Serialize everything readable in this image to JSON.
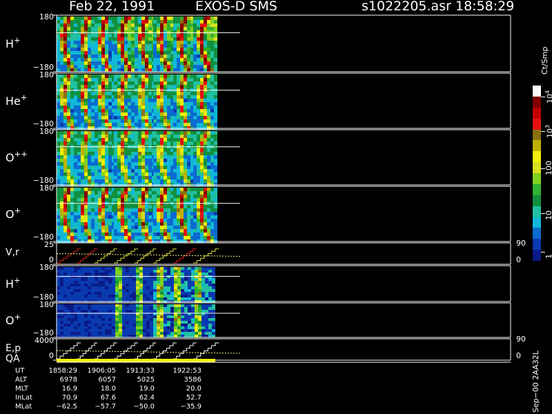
{
  "header": {
    "date": "Feb 22, 1991",
    "instrument": "EXOS-D SMS",
    "file": "s1022205.asr",
    "time": "18:58:29"
  },
  "chart_data": {
    "type": "heatmap",
    "panels": [
      {
        "id": "h_plus",
        "species": "H",
        "charge": "+",
        "ymax": "180",
        "ymin": "−180"
      },
      {
        "id": "he_plus",
        "species": "He",
        "charge": "+",
        "ymax": "180",
        "ymin": "−180"
      },
      {
        "id": "o_pp",
        "species": "O",
        "charge": "++",
        "ymax": "180",
        "ymin": "−180"
      },
      {
        "id": "o_plus",
        "species": "O",
        "charge": "+",
        "ymax": "180",
        "ymin": "−180"
      },
      {
        "id": "vr",
        "label": "V,r",
        "ymax": "25",
        "ymin": "0",
        "right_top": "90",
        "right_bottom": "0"
      },
      {
        "id": "h_plus_2",
        "species": "H",
        "charge": "+",
        "ymax": "180",
        "ymin": "−180"
      },
      {
        "id": "o_plus_2",
        "species": "O",
        "charge": "+",
        "ymax": "180",
        "ymin": "−180"
      },
      {
        "id": "ep",
        "label": "E,p",
        "ymax": "4000",
        "ymin": "0",
        "right_top": "90",
        "right_bottom": "0"
      }
    ],
    "qa_label": "QA",
    "spin_bands": 8,
    "colorbar": {
      "units": "Ct/Smp",
      "labels": [
        "1",
        "10",
        "100"
      ],
      "label_1e3": "10",
      "label_1e3_exp": "3",
      "label_1e4": "10",
      "label_1e4_exp": "4",
      "colors": [
        "#0a1a88",
        "#0a3ab0",
        "#0a6ad0",
        "#10b8d8",
        "#20c0a0",
        "#109040",
        "#30b030",
        "#80d020",
        "#d8e020",
        "#f0f000",
        "#c0b000",
        "#8a7010",
        "#e81010",
        "#c00000",
        "#800000",
        "#f8f8f8"
      ]
    }
  },
  "footer": {
    "rows": [
      {
        "label": "UT",
        "values": [
          "1858:29",
          "1906:05",
          "1913:33",
          "1922:53"
        ]
      },
      {
        "label": "ALT",
        "values": [
          "6978",
          "6057",
          "5025",
          "3586"
        ]
      },
      {
        "label": "MLT",
        "values": [
          "16.9",
          "18.0",
          "19.0",
          "20.0"
        ]
      },
      {
        "label": "InLat",
        "values": [
          "70.9",
          "67.6",
          "62.4",
          "52.7"
        ]
      },
      {
        "label": "MLat",
        "values": [
          "−62.5",
          "−57.7",
          "−50.0",
          "−35.9"
        ]
      }
    ],
    "stamp": "Sep−00  2AA32L"
  }
}
